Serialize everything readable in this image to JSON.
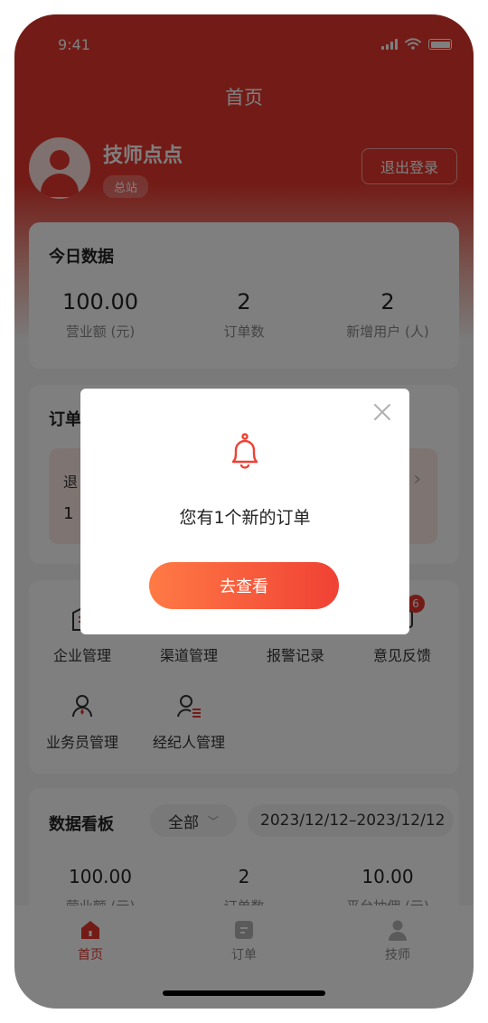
{
  "status_bar": {
    "time": "9:41"
  },
  "nav": {
    "title": "首页"
  },
  "user": {
    "name": "技师点点",
    "tag": "总站",
    "logout_label": "退出登录"
  },
  "today": {
    "title": "今日数据",
    "stats": [
      {
        "value": "100.00",
        "label": "营业额 (元)"
      },
      {
        "value": "2",
        "label": "订单数"
      },
      {
        "value": "2",
        "label": "新增用户 (人)"
      }
    ]
  },
  "orders": {
    "title": "订单",
    "inner_label": "退",
    "inner_count": "1"
  },
  "grid": {
    "items": [
      {
        "label": "企业管理",
        "icon": "building-icon"
      },
      {
        "label": "渠道管理",
        "icon": "channel-icon"
      },
      {
        "label": "报警记录",
        "icon": "alarm-icon"
      },
      {
        "label": "意见反馈",
        "icon": "feedback-icon",
        "badge": "6"
      },
      {
        "label": "业务员管理",
        "icon": "salesman-icon"
      },
      {
        "label": "经纪人管理",
        "icon": "agent-icon"
      }
    ]
  },
  "dashboard": {
    "title": "数据看板",
    "filter": "全部",
    "date_range": "2023/12/12–2023/12/12",
    "stats": [
      {
        "value": "100.00",
        "label": "营业额 (元)"
      },
      {
        "value": "2",
        "label": "订单数"
      },
      {
        "value": "10.00",
        "label": "平台抽佣 (元)"
      }
    ]
  },
  "tabbar": {
    "items": [
      {
        "label": "首页",
        "icon": "home-icon",
        "active": true
      },
      {
        "label": "订单",
        "icon": "order-icon",
        "active": false
      },
      {
        "label": "技师",
        "icon": "technician-icon",
        "active": false
      }
    ]
  },
  "modal": {
    "icon": "bell-icon",
    "message": "您有1个新的订单",
    "button_label": "去查看"
  },
  "colors": {
    "primary": "#e6382f",
    "accent_gradient_start": "#ff7a45",
    "accent_gradient_end": "#f04134"
  }
}
